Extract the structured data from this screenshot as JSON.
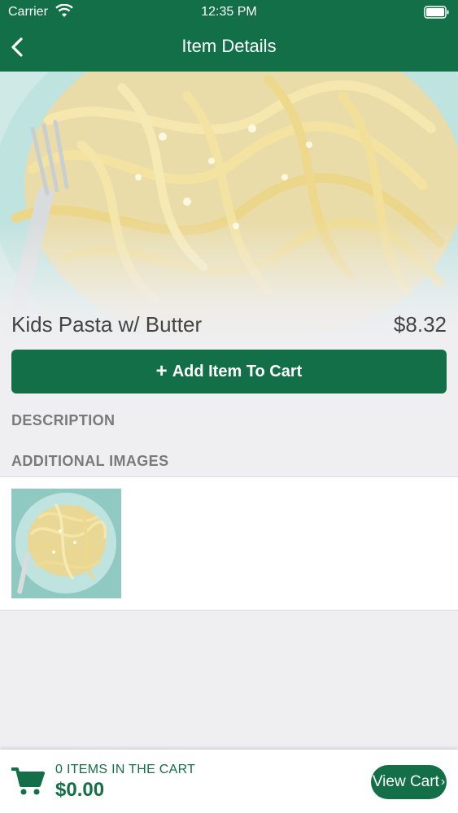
{
  "status_bar": {
    "carrier": "Carrier",
    "time": "12:35 PM"
  },
  "nav": {
    "title": "Item Details",
    "back_icon": "chevron-left-icon"
  },
  "item": {
    "name": "Kids Pasta w/ Butter",
    "price": "$8.32"
  },
  "add_button": {
    "icon": "+",
    "label": "Add Item To Cart"
  },
  "sections": {
    "description": "DESCRIPTION",
    "additional_images": "ADDITIONAL IMAGES"
  },
  "cart": {
    "count_label": "0 ITEMS IN THE CART",
    "total": "$0.00",
    "button_label": "View Cart",
    "button_chevron": "›"
  },
  "colors": {
    "brand": "#136f47",
    "background": "#efeff1"
  }
}
